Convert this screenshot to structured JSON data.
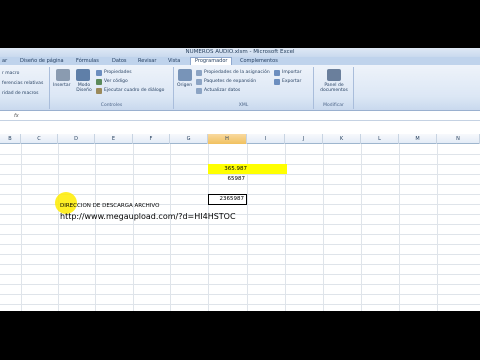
{
  "window": {
    "title": "NUMEROS AUDIO.xlsm - Microsoft Excel"
  },
  "tabs": [
    {
      "label": "ar"
    },
    {
      "label": "Diseño de página"
    },
    {
      "label": "Fórmulas"
    },
    {
      "label": "Datos"
    },
    {
      "label": "Revisar"
    },
    {
      "label": "Vista"
    },
    {
      "label": "Programador"
    },
    {
      "label": "Complementos"
    }
  ],
  "ribbon": {
    "code_group": {
      "items": [
        "r macro",
        "ferencias relativas",
        "ridad de macros"
      ]
    },
    "controls_group": {
      "label": "Controles",
      "insert_label": "Insertar",
      "design_label": "Modo Diseño",
      "items": [
        "Propiedades",
        "Ver código",
        "Ejecutar cuadro de diálogo"
      ]
    },
    "xml_group": {
      "label": "XML",
      "source_label": "Origen",
      "items": [
        "Propiedades de la asignación",
        "Paquetes de expansión",
        "Actualizar datos"
      ],
      "import_label": "Importar",
      "export_label": "Exportar"
    },
    "modify_group": {
      "label": "Modificar",
      "panel_label": "Panel de documentos"
    }
  },
  "columns": [
    "B",
    "C",
    "D",
    "E",
    "F",
    "G",
    "H",
    "I",
    "J",
    "K",
    "L",
    "M",
    "N"
  ],
  "selected_column": "H",
  "cells": {
    "h_row1": "365.987",
    "h_row2": "65987",
    "h_row4": "2365987",
    "description": "DIRECCION DE DESCARGA ARCHIVO",
    "url": "http://www.megaupload.com/?d=HI4HSTOC"
  },
  "colors": {
    "highlight": "#ffff00",
    "cursor_highlight": "#ffec00",
    "selected_header": "#f1c15f"
  }
}
